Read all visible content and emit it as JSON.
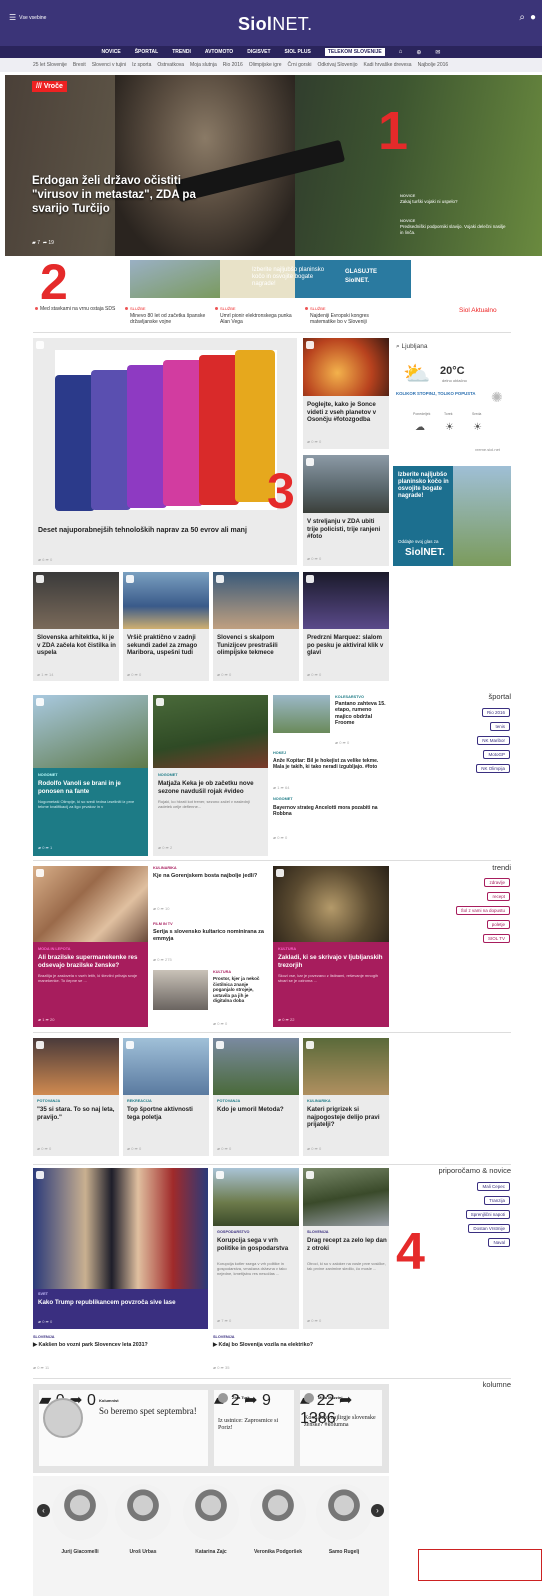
{
  "header": {
    "menu_label": "Vse vsebine",
    "logo_main": "Siol",
    "logo_net": "NET."
  },
  "nav": {
    "items": [
      "NOVICE",
      "ŠPORTAL",
      "TRENDI",
      "AVTOMOTO",
      "DIGISVET",
      "SIOL PLUS"
    ],
    "selected": "TELEKOM SLOVENIJE"
  },
  "subnav": [
    "25 let Slovenije",
    "Brexit",
    "Slovenci v tujini",
    "Iz sporta",
    "Ostrvatkova",
    "Moja slutnja",
    "Rio 2016",
    "Olimpijske igre",
    "Črni gorski",
    "Odkrivaj Slovenijo",
    "Kadi hrvaške drevesa",
    "Najbolje 2016"
  ],
  "hero": {
    "badge": "Vroče",
    "title": "Erdogan želi državo očistiti \"virusov in metastaz\", ZDA pa svarijo Turčijo",
    "comments": "7",
    "shares": "19",
    "side": [
      {
        "cat": "NOVICE",
        "text": "Zakaj turški vojaki ni uspelo?"
      },
      {
        "cat": "NOVICE",
        "text": "Predsedniški podporniki slavijo. Vojaki delečni nasilje in linča."
      }
    ]
  },
  "annotations": {
    "n1": "1",
    "n2": "2",
    "n3": "3",
    "n4": "4"
  },
  "banner": {
    "text": "Izberite najljubšo planinsko kočo in osvojite bogate nagrade!",
    "cta": "GLASUJTE",
    "brand": "SiolNET."
  },
  "ticker": {
    "label": "Siol Aktualno",
    "items": [
      {
        "cat": "",
        "text": "Med stavkami na vrnu ostaja SDS"
      },
      {
        "cat": "SLUŽBE",
        "text": "Minevo 80 let od začetka španske državljanske vojne"
      },
      {
        "cat": "SLUŽBE",
        "text": "Umrl pionir elektronskega punka Alan Vega"
      },
      {
        "cat": "SLUŽBE",
        "text": "Najdeniji Evropski kongres matematike bo v Sloveniji"
      }
    ]
  },
  "feature": {
    "title": "Deset najuporabnejših tehnoloških naprav za 50 evrov ali manj",
    "comments": "6",
    "shares": "0"
  },
  "side_cards": [
    {
      "title": "Poglejte, kako je Sonce videti z vseh planetov v Osončju #fotozgodba",
      "c": "0",
      "s": "0"
    },
    {
      "title": "V streljanju v ZDA ubiti trije policisti, trije ranjeni #foto",
      "c": "0",
      "s": "0"
    }
  ],
  "weather": {
    "city": "Ljubljana",
    "temp": "20°C",
    "desc": "delno oblačno",
    "promo": "KOLIKOR STOPINJ, TOLIKO POPUSTA",
    "days": [
      "Ponedeljek",
      "Torek",
      "Sreda"
    ],
    "link": "vreme.siol.net"
  },
  "ad2": {
    "text": "Izberite najljubšo planinsko kočo in osvojite bogate nagrade!",
    "cta": "Oddajte svoj glas za",
    "brand": "SiolNET."
  },
  "row1": [
    {
      "title": "Slovenska arhitektka, ki je v ZDA začela kot čistilka in uspela",
      "c": "1",
      "s": "14"
    },
    {
      "title": "Vršič praktično v zadnji sekundi zadel za zmago Maribora, uspešni tudi",
      "c": "0",
      "s": "0"
    },
    {
      "title": "Slovenci s skalpom Tunizijcev prestrašili olimpijske tekmece",
      "c": "0",
      "s": "0"
    },
    {
      "title": "Predrzni Marquez: slalom po pesku je aktiviral klik v glavi",
      "c": "0",
      "s": "0"
    }
  ],
  "sport": {
    "heading": "športal",
    "tags": [
      "Rio 2016",
      "tenis",
      "NK Maribor",
      "MotoGP",
      "NK Olimpija"
    ],
    "teal": {
      "cat": "NOGOMET",
      "title": "Rodolfo Vanoli se brani in je ponosen na fante",
      "text": "Nogometaši Olimpije, ki so sredi tedna izseliniti iz prve tekme kvalifikacij za ligo prvakov in v",
      "c": "0",
      "s": "1"
    },
    "gray": {
      "cat": "NOGOMET",
      "title": "Matjaža Keka je ob začetku nove sezone navdušil rojak #video",
      "text": "Rojaki, ko hkrati kot trener, sezono začel v naslednji zadetek celje deflenne...",
      "c": "0",
      "s": "2"
    },
    "small": {
      "cat": "KOLESARSTVO",
      "title": "Pantano zahteva 15. etapo, rumeno majico obdržal Froome",
      "c": "0",
      "s": "0"
    },
    "list": [
      {
        "cat": "HOKEJ",
        "text": "Anže Kopitar: Bil je hokejist za velike tekme. Mala je takih, ki tako neradi izgubljajo. #foto",
        "c": "1",
        "s": "64"
      },
      {
        "cat": "NOGOMET",
        "text": "Bayernov strateg Ancelotti mora pozabiti na Robbna",
        "c": "0",
        "s": "0"
      }
    ]
  },
  "trendi": {
    "heading": "trendi",
    "tags": [
      "zdravlje",
      "recept",
      "Šol z vami na dopustu",
      "poletje",
      "SIOL TV"
    ],
    "mag": {
      "cat": "MODA IN LEPOTA",
      "title": "Ali brazilske supermanekenke res odsevajo brazilske ženske?",
      "text": "Brazilija je zaslovela v vseh letih, ki številni prihaja svoje manekenke. To čepne se ...",
      "c": "1",
      "s": "20"
    },
    "mid": [
      {
        "cat": "KULINARIKA",
        "title": "Kje na Gorenjskem bosta najbolje jedli?",
        "c": "0",
        "s": "10"
      },
      {
        "cat": "FILM IN TV",
        "title": "Serija s slovensko kultarico nominirana za emmyja",
        "c": "0",
        "s": "275"
      },
      {
        "cat": "KULTURA",
        "title": "Prostor, kjer ja nekoč čistilnica znanje poganjalo strojeje, ustavila pa jih je digitalna doba",
        "c": "0",
        "s": "0"
      }
    ],
    "right": {
      "cat": "KULTURA",
      "title": "Zakladi, ki se skrivajo v ljubljanskih trezorjih",
      "text": "Skozi vse, kar je povezano z listinami, reševanje mnogih stvari se je oziroma ...",
      "c": "0",
      "s": "22"
    }
  },
  "row2": [
    {
      "cat": "POTOVANJA",
      "title": "\"35 si stara. To so naj leta, pravijo.\"",
      "c": "0",
      "s": "0"
    },
    {
      "cat": "REKREACIJA",
      "title": "Top športne aktivnosti tega poletja",
      "c": "0",
      "s": "0"
    },
    {
      "cat": "POTOVANJA",
      "title": "Kdo je umoril Metoda?",
      "c": "0",
      "s": "0"
    },
    {
      "cat": "KULINARIKA",
      "title": "Kateri prigrizek si najpogosteje delijo pravi prijatelji?",
      "c": "0",
      "s": "0"
    }
  ],
  "recommend": {
    "heading": "priporočamo & novice",
    "tags": [
      "Mali Cepec",
      "Tranzija",
      "Sprenjlični napoti",
      "Dostan Vrstmije",
      "Naval"
    ],
    "big": {
      "cat": "SVET",
      "title": "Kako Trump republikancem povzroča sive lase",
      "c": "0",
      "s": "0"
    },
    "right": [
      {
        "cat": "GOSPODARSTVO",
        "title": "Korupcija sega v vrh politike in gospodarstva",
        "text": "Korupcija kotler ssega v vrh politike in gospodarstva, vmačana državna v tako nejedne, kmetijstvu res nesočlas ...",
        "c": "7",
        "s": "0"
      },
      {
        "cat": "SLOVENIJA",
        "title": "Drag recept za zelo lep dan z otroki",
        "text": "Otroci, ki so v zaloker na vosle prve vosičke, tak prvine zanimive sledilo, čo mosle ...",
        "c": "0",
        "s": "0"
      }
    ],
    "bottom": [
      {
        "cat": "SLOVENIJA",
        "text": "Kakšen bo vozni park Slovencev leta 2031?",
        "c": "0",
        "s": "11"
      },
      {
        "cat": "SLOVENIJA",
        "text": "Kdaj bo Slovenija vozila na elektriko?",
        "c": "0",
        "s": "35"
      }
    ]
  },
  "kolumne": {
    "heading": "kolumne",
    "cards": [
      {
        "author": "Kolumnist",
        "title": "So beremo spet septembra!",
        "c": "0",
        "s": "0"
      },
      {
        "author": "Žiga Turk",
        "title": "Iz ustnice: Zaprosmice si Poriz!",
        "c": "2",
        "s": "9"
      },
      {
        "author": "Miha Mazzini",
        "title": "Kdo lakko najlirgje slovenske ženske? #kolumna",
        "c": "22",
        "s": "1386"
      }
    ],
    "people": [
      "Jurij Giacomelli",
      "Uroš Urbas",
      "Katarina Zajc",
      "Veronika Podgoršek",
      "Samo Rugelj"
    ]
  }
}
